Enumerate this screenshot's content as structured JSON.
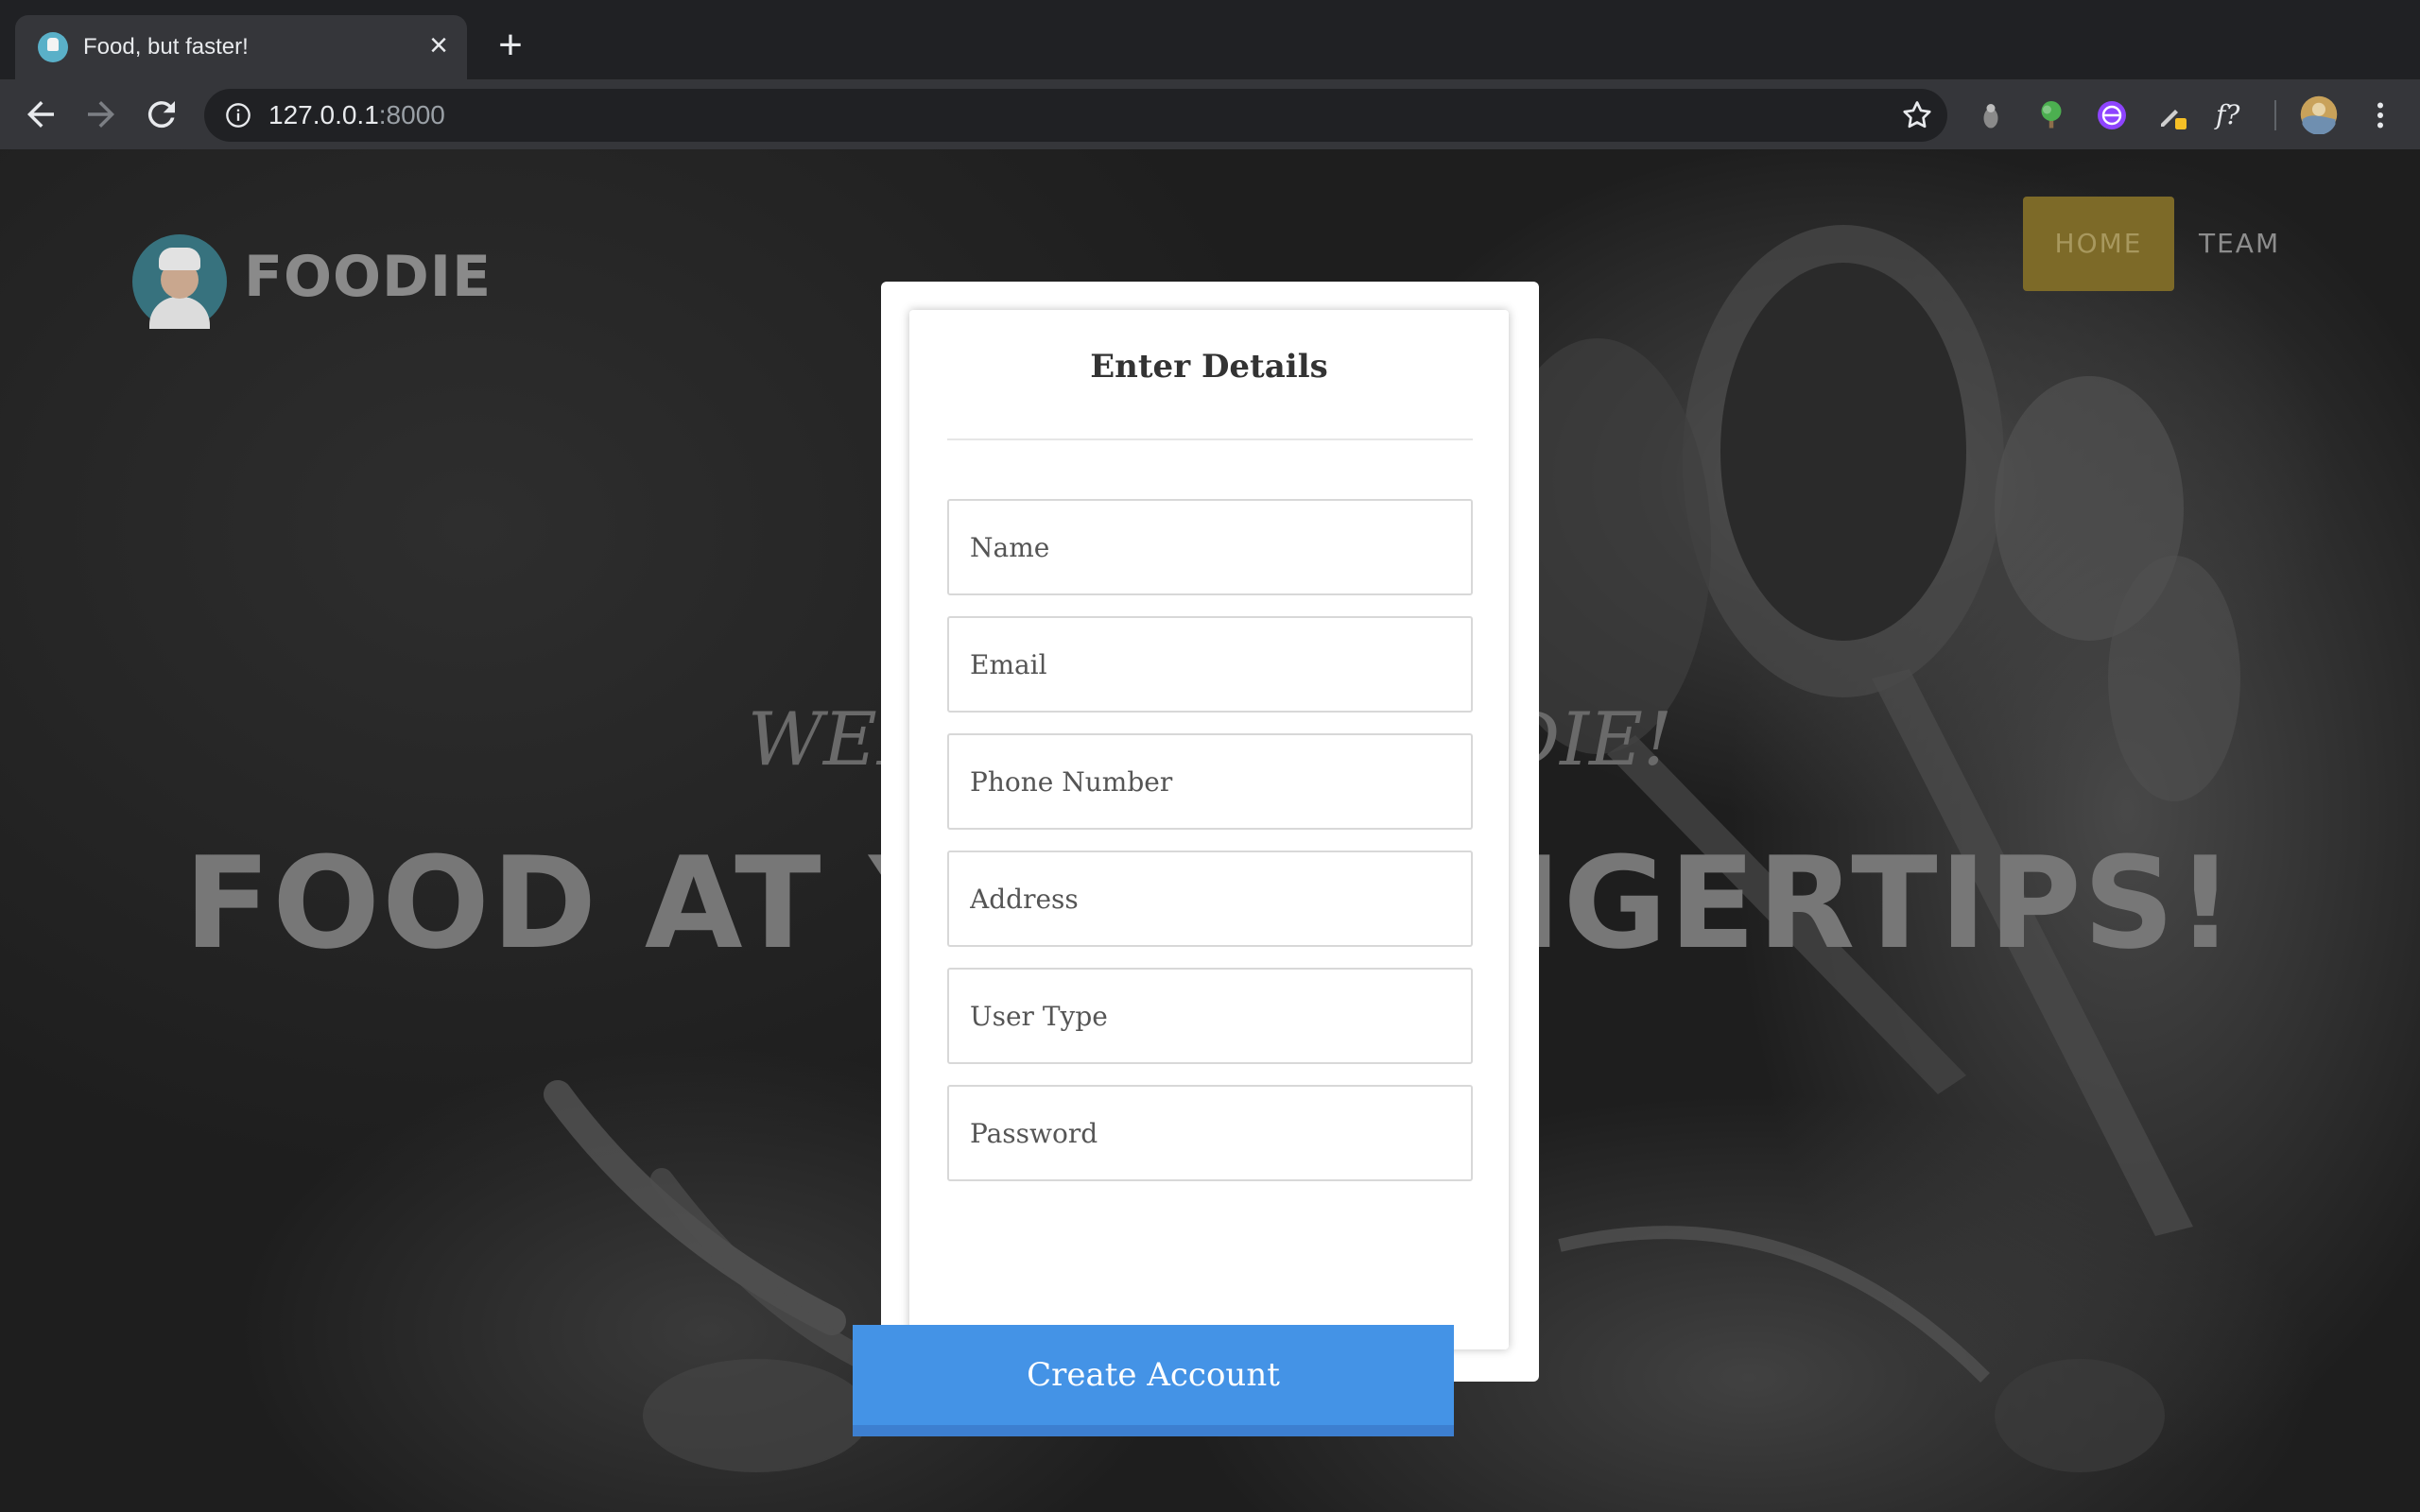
{
  "browser": {
    "tab_title": "Food, but faster!",
    "tab_close": "×",
    "new_tab": "+",
    "url_host": "127.0.0.1",
    "url_port": ":8000",
    "extensions": [
      "profile-icon",
      "tree-icon",
      "globe-extension-icon",
      "pencil-extension-icon",
      "formula-icon"
    ],
    "formula_label": "f?"
  },
  "site": {
    "brand": "FOODIE",
    "nav": {
      "home": "HOME",
      "team": "TEAM"
    },
    "hero_subtitle": "WELCOME TO FOODIE!",
    "hero_title": "FOOD AT YOUR FINGERTIPS!"
  },
  "modal": {
    "title": "Enter Details",
    "fields": {
      "name": {
        "placeholder": "Name",
        "value": ""
      },
      "email": {
        "placeholder": "Email",
        "value": ""
      },
      "phone": {
        "placeholder": "Phone Number",
        "value": ""
      },
      "address": {
        "placeholder": "Address",
        "value": ""
      },
      "user_type": {
        "placeholder": "User Type",
        "value": ""
      },
      "password": {
        "placeholder": "Password",
        "value": ""
      }
    },
    "submit_label": "Create Account"
  },
  "colors": {
    "accent": "#4493e6",
    "nav_active": "#7d6a28",
    "chrome_dark": "#202124",
    "chrome_toolbar": "#35363a"
  }
}
